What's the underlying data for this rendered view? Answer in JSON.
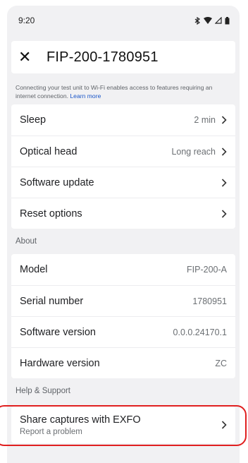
{
  "status_bar": {
    "time": "9:20",
    "icons": [
      "bluetooth-icon",
      "wifi-icon",
      "signal-icon",
      "battery-icon"
    ]
  },
  "header": {
    "close_icon": "✕",
    "title": "FIP-200-1780951"
  },
  "info": {
    "text": "Connecting your test unit to Wi-Fi enables access to features requiring an internet connection.",
    "link": "Learn more"
  },
  "settings": [
    {
      "label": "Sleep",
      "value": "2 min"
    },
    {
      "label": "Optical head",
      "value": "Long reach"
    },
    {
      "label": "Software update",
      "value": ""
    },
    {
      "label": "Reset options",
      "value": ""
    }
  ],
  "about": {
    "section_label": "About",
    "rows": [
      {
        "label": "Model",
        "value": "FIP-200-A"
      },
      {
        "label": "Serial number",
        "value": "1780951"
      },
      {
        "label": "Software version",
        "value": "0.0.0.24170.1"
      },
      {
        "label": "Hardware version",
        "value": "ZC"
      }
    ]
  },
  "help": {
    "section_label": "Help & Support",
    "share_title": "Share captures with EXFO",
    "share_subtitle": "Report a problem"
  },
  "colors": {
    "background": "#f1f1f3",
    "card": "#ffffff",
    "link": "#1a56c8",
    "highlight": "#e01f1f"
  }
}
